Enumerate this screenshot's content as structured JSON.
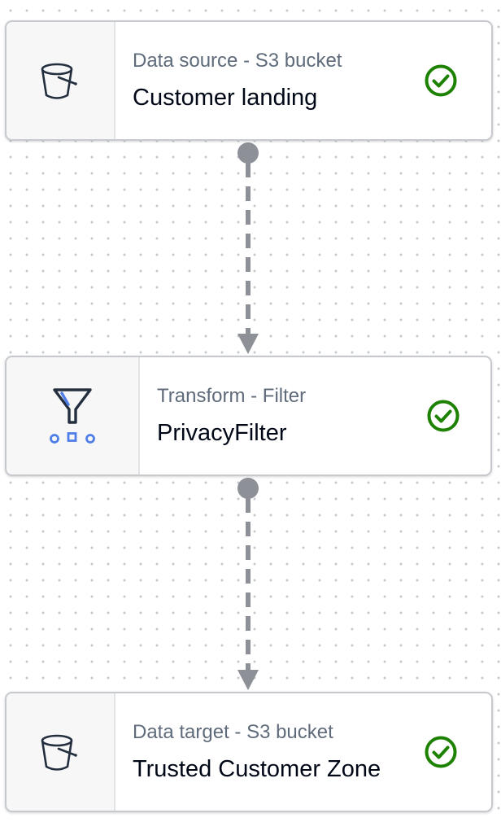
{
  "nodes": [
    {
      "type_label": "Data source - S3 bucket",
      "name": "Customer landing",
      "icon": "s3-bucket-icon",
      "status": "check-circle-icon"
    },
    {
      "type_label": "Transform - Filter",
      "name": "PrivacyFilter",
      "icon": "filter-funnel-icon",
      "status": "check-circle-icon"
    },
    {
      "type_label": "Data target - S3 bucket",
      "name": "Trusted Customer Zone",
      "icon": "s3-bucket-icon",
      "status": "check-circle-icon"
    }
  ],
  "edges": [
    {
      "from": "Customer landing",
      "to": "PrivacyFilter"
    },
    {
      "from": "PrivacyFilter",
      "to": "Trusted Customer Zone"
    }
  ],
  "colors": {
    "status_ok": "#1d8102",
    "edge": "#8d9096",
    "filter_accent": "#4f7ee8",
    "icon_stroke": "#232f3e"
  }
}
